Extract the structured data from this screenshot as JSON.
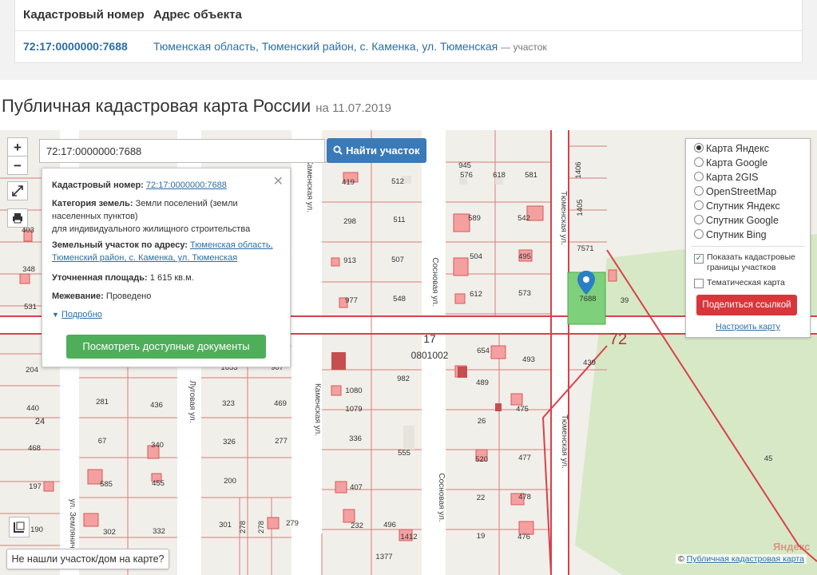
{
  "table": {
    "col_cadastral": "Кадастровый номер",
    "col_address": "Адрес объекта",
    "row": {
      "cadastral": "72:17:0000000:7688",
      "address": "Тюменская область, Тюменский район, с. Каменка, ул. Тюменская",
      "type_note": "— участок"
    }
  },
  "page_title": {
    "title": "Публичная кадастровая карта России",
    "date": "на 11.07.2019"
  },
  "map": {
    "zoom_in": "+",
    "zoom_out": "−",
    "search_value": "72:17:0000000:7688",
    "search_button": "Найти участок",
    "popup": {
      "cad_label": "Кадастровый номер:",
      "cad_value": "72:17:0000000:7688",
      "category_label": "Категория земель:",
      "category_value": "Земли поселений (земли населенных пунктов)",
      "category_value2": "для индивидуального жилищного строительства",
      "address_label": "Земельный участок по адресу:",
      "address_value": "Тюменская область, Тюменский район, с. Каменка, ул. Тюменская",
      "area_label": "Уточненная площадь:",
      "area_value": "1 615 кв.м.",
      "survey_label": "Межевание:",
      "survey_value": "Проведено",
      "more_link": "Подробно",
      "docs_button": "Посмотреть доступные документы"
    },
    "layers": {
      "options": [
        "Карта Яндекс",
        "Карта Google",
        "Карта 2GIS",
        "OpenStreetMap",
        "Спутник Яндекс",
        "Спутник Google",
        "Спутник Bing"
      ],
      "selected": "Карта Яндекс",
      "show_boundaries": "Показать кадастровые границы участков",
      "thematic": "Тематическая карта",
      "share_button": "Поделиться ссылкой",
      "settings_link": "Настроить карту"
    },
    "not_found": "Не нашли участок/дом на карте?",
    "attribution": {
      "prefix": "©",
      "link": "Публичная кадастровая карта"
    },
    "yandex_logo": "Яндекс",
    "labels": {
      "big_block": "17",
      "big_quarter": "0801002",
      "region_72": "72",
      "parcel_7688": "7688",
      "p39": "39",
      "p439": "439",
      "p45": "45",
      "p24": "24",
      "p945": "945",
      "p576": "576",
      "p618": "618",
      "p581": "581",
      "p419": "419",
      "p512": "512",
      "p298": "298",
      "p511": "511",
      "p913": "913",
      "p507": "507",
      "p977": "977",
      "p548": "548",
      "p589": "589",
      "p542": "542",
      "p504": "504",
      "p495": "495",
      "p612": "612",
      "p573": "573",
      "p7571": "7571",
      "p1406": "1406",
      "p1405": "1405",
      "p654": "654",
      "p493": "493",
      "p489": "489",
      "p475": "475",
      "p26": "26",
      "p520": "520",
      "p477": "477",
      "p22": "22",
      "p478": "478",
      "p19": "19",
      "p476": "476",
      "p1080": "1080",
      "p1079": "1079",
      "p336": "336",
      "p982": "982",
      "p555": "555",
      "p407": "407",
      "p232": "232",
      "p496": "496",
      "p1412": "1412",
      "p1377": "1377",
      "p1653": "1653",
      "p907": "907",
      "p323": "323",
      "p469": "469",
      "p326": "326",
      "p277": "277",
      "p200": "200",
      "p301": "301",
      "p278a": "278",
      "p278b": "278",
      "p279": "279",
      "p281": "281",
      "p436": "436",
      "p67": "67",
      "p340": "340",
      "p585": "585",
      "p455": "455",
      "p302": "302",
      "p332": "332",
      "p204": "204",
      "p440": "440",
      "p468": "468",
      "p197": "197",
      "p190": "190",
      "p403": "403",
      "p348": "348",
      "p531": "531",
      "st_kamenskaya1": "Каменская ул.",
      "st_sosnovaya1": "Сосновая ул.",
      "st_tyumenskaya1": "Тюменская ул.",
      "st_lugovaya": "Луговая ул.",
      "st_kamenskaya2": "Каменская ул.",
      "st_sosnovaya2": "Сосновая ул.",
      "st_tyumenskaya2": "Тюменская ул.",
      "st_zemlyanichnaya": "ул. Земляничног"
    }
  }
}
